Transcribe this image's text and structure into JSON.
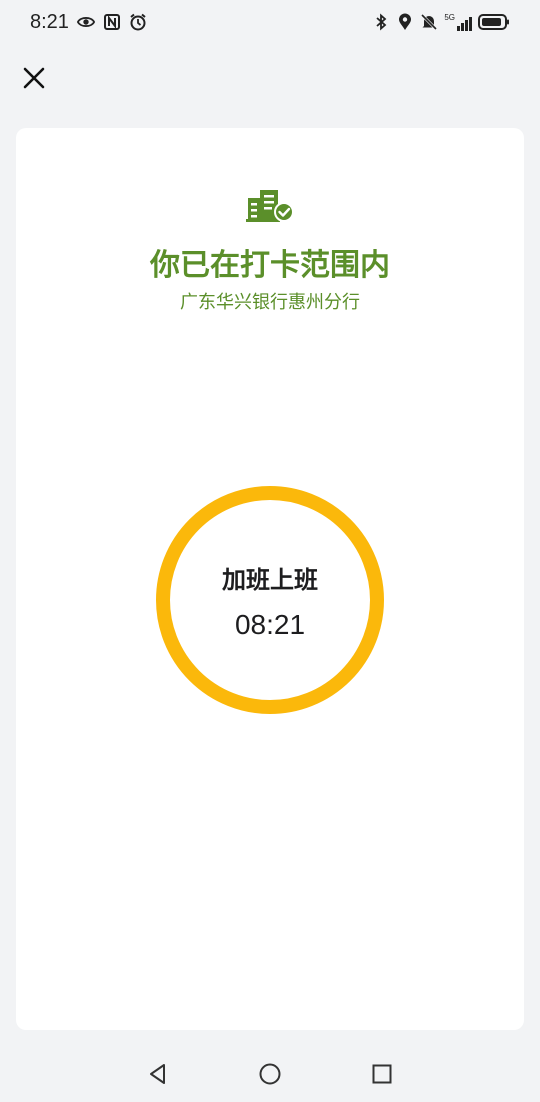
{
  "status_bar": {
    "time": "8:21",
    "left_icons": [
      "eye-icon",
      "nfc-icon",
      "alarm-icon"
    ],
    "right_icons": [
      "bluetooth-icon",
      "location-icon",
      "mute-icon",
      "signal-5g-icon",
      "battery-icon"
    ],
    "network_label": "5G"
  },
  "close_label": "×",
  "card": {
    "title": "你已在打卡范围内",
    "subtitle": "广东华兴银行惠州分行",
    "icon": "building-check-icon",
    "clock_in": {
      "label": "加班上班",
      "time": "08:21"
    }
  },
  "colors": {
    "accent_green": "#5b8f2a",
    "ring_yellow": "#fbb80b",
    "background": "#f2f3f5",
    "card": "#ffffff"
  },
  "nav": {
    "icons": [
      "back-icon",
      "home-icon",
      "recents-icon"
    ]
  }
}
